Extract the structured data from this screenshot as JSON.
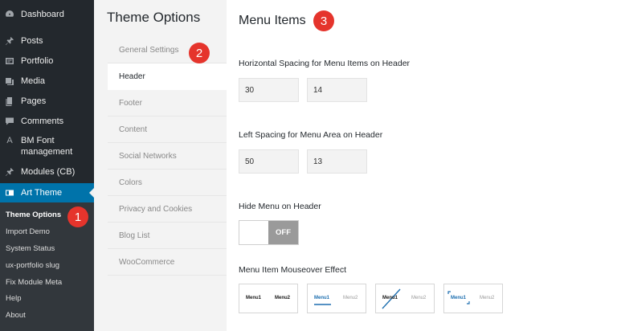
{
  "wp_menu": {
    "items": [
      {
        "label": "Dashboard",
        "icon": "dashboard-icon"
      },
      {
        "label": "Posts",
        "icon": "pin-icon"
      },
      {
        "label": "Portfolio",
        "icon": "portfolio-icon"
      },
      {
        "label": "Media",
        "icon": "media-icon"
      },
      {
        "label": "Pages",
        "icon": "pages-icon"
      },
      {
        "label": "Comments",
        "icon": "comment-icon"
      },
      {
        "label": "BM Font",
        "label2": "management",
        "icon": "font-icon",
        "icon_glyph": "A"
      },
      {
        "label": "Modules (CB)",
        "icon": "pin-icon"
      },
      {
        "label": "Art Theme",
        "icon": "art-theme-icon"
      }
    ],
    "submenu": [
      "Theme Options",
      "Import Demo",
      "System Status",
      "ux-portfolio slug",
      "Fix Module Meta",
      "Help",
      "About"
    ]
  },
  "theme_options": {
    "title": "Theme Options",
    "nav": [
      "General Settings",
      "Header",
      "Footer",
      "Content",
      "Social Networks",
      "Colors",
      "Privacy and Cookies",
      "Blog List",
      "WooCommerce"
    ],
    "active_nav": "Header"
  },
  "section": {
    "title": "Menu Items",
    "horizontal_spacing": {
      "label": "Horizontal Spacing for Menu Items on Header",
      "values": [
        "30",
        "14"
      ]
    },
    "left_spacing": {
      "label": "Left Spacing for Menu Area on Header",
      "values": [
        "50",
        "13"
      ]
    },
    "hide_menu": {
      "label": "Hide Menu on Header",
      "state": "OFF"
    },
    "mouseover": {
      "label": "Menu Item Mouseover Effect",
      "options": [
        {
          "item1": "Menu1",
          "item2": "Menu2"
        },
        {
          "item1": "Menu1",
          "item2": "Menu2"
        },
        {
          "item1": "Menu1",
          "item2": "Menu2"
        },
        {
          "item1": "Menu1",
          "item2": "Menu2"
        }
      ]
    }
  },
  "badges": [
    "1",
    "2",
    "3"
  ],
  "colors": {
    "sidebar": "#23282d",
    "submenu": "#32373c",
    "accent": "#0073aa",
    "badge": "#e5342c",
    "toggle_off": "#9a9a9a"
  }
}
